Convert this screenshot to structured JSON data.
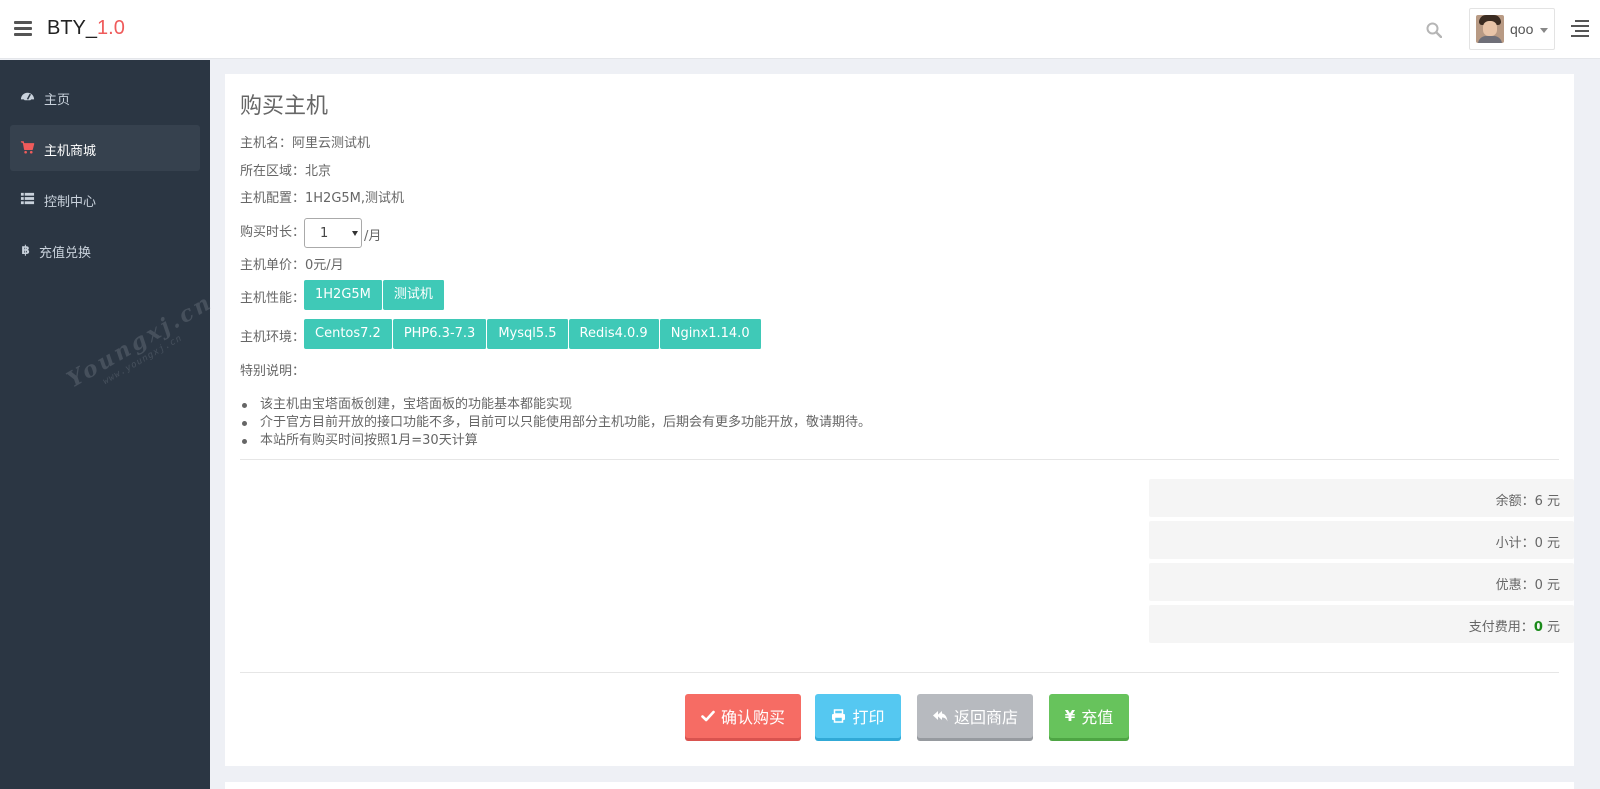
{
  "header": {
    "brand_prefix": "BTY_",
    "brand_version": "1.0",
    "username": "qoo"
  },
  "sidebar": {
    "items": [
      {
        "label": "主页",
        "icon": "dashboard-icon"
      },
      {
        "label": "主机商城",
        "icon": "cart-icon",
        "active": true
      },
      {
        "label": "控制中心",
        "icon": "list-icon"
      },
      {
        "label": "充值兑换",
        "icon": "bitcoin-icon"
      }
    ]
  },
  "main": {
    "title": "购买主机",
    "host_name": "主机名：阿里云测试机",
    "region": "所在区域：北京",
    "config": "主机配置：1H2G5M,测试机",
    "duration_label": "购买时长：",
    "duration_value": "1",
    "per_month": "/月",
    "unit_price": "主机单价：0元/月",
    "performance_label": "主机性能：",
    "performance_tags": [
      "1H2G5M",
      "测试机"
    ],
    "env_label": "主机环境：",
    "env_tags": [
      "Centos7.2",
      "PHP6.3-7.3",
      "Mysql5.5",
      "Redis4.0.9",
      "Nginx1.14.0"
    ],
    "notes_label": "特别说明：",
    "notes": [
      "该主机由宝塔面板创建，宝塔面板的功能基本都能实现",
      "介于官方目前开放的接口功能不多，目前可以只能使用部分主机功能，后期会有更多功能开放，敬请期待。",
      "本站所有购买时间按照1月=30天计算"
    ]
  },
  "summary": {
    "balance": "余额：6 元",
    "subtotal": "小计：0 元",
    "discount": "优惠：0 元",
    "pay_label": "支付费用：",
    "pay_value": "0",
    "pay_unit": " 元"
  },
  "buttons": {
    "confirm": "确认购买",
    "print": "打印",
    "back": "返回商店",
    "recharge": "充值"
  },
  "watermark": {
    "main": "Youngxj.cn",
    "sub": "www.youngxj.cn"
  },
  "colors": {
    "sidebar_bg": "#2b3643",
    "brand_accent": "#ef5b5b",
    "tag_teal": "#3fc9b7",
    "btn_red": "#f66c64",
    "btn_blue": "#55c8f1",
    "btn_gray": "#b7babf",
    "btn_green": "#67c35c"
  }
}
